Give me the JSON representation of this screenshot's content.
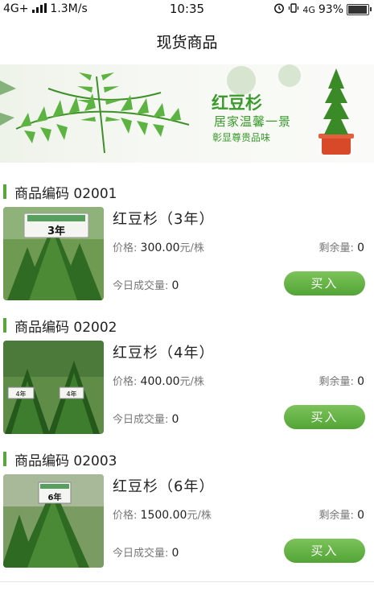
{
  "status": {
    "signal": "4G+",
    "speed": "1.3M/s",
    "time": "10:35",
    "network": "4G",
    "battery": "93%"
  },
  "nav": {
    "title": "现货商品"
  },
  "banner": {
    "title": "红豆杉",
    "line1": "居家温馨一景",
    "line2": "彰显尊贵品味",
    "page_count": 2,
    "active_page": 2
  },
  "accent_color": "#5aa63d",
  "products": [
    {
      "code_label": "商品编码",
      "code": "02001",
      "name": "红豆杉（3年）",
      "tag_text": "3年",
      "price_label": "价格:",
      "price": "300.00",
      "unit": "元/株",
      "remain_label": "剩余量:",
      "remain": "0",
      "volume_label": "今日成交量:",
      "volume": "0",
      "buy_label": "买入"
    },
    {
      "code_label": "商品编码",
      "code": "02002",
      "name": "红豆杉（4年）",
      "tag_text": "4年",
      "price_label": "价格:",
      "price": "400.00",
      "unit": "元/株",
      "remain_label": "剩余量:",
      "remain": "0",
      "volume_label": "今日成交量:",
      "volume": "0",
      "buy_label": "买入"
    },
    {
      "code_label": "商品编码",
      "code": "02003",
      "name": "红豆杉（6年）",
      "tag_text": "6年",
      "price_label": "价格:",
      "price": "1500.00",
      "unit": "元/株",
      "remain_label": "剩余量:",
      "remain": "0",
      "volume_label": "今日成交量:",
      "volume": "0",
      "buy_label": "买入"
    }
  ]
}
